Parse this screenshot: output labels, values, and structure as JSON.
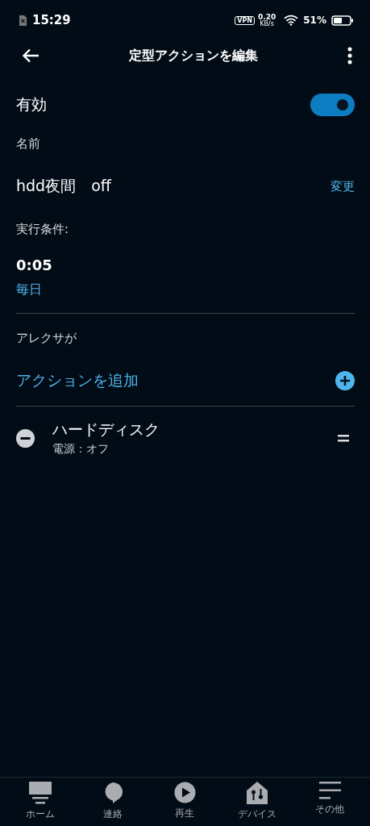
{
  "status_bar": {
    "time": "15:29",
    "vpn": "VPN",
    "speed": "0.20",
    "speed_unit": "KB/s",
    "battery": "51%"
  },
  "header": {
    "title": "定型アクションを編集"
  },
  "enabled": {
    "label": "有効",
    "on": true
  },
  "name": {
    "label": "名前",
    "value": "hdd夜間　off",
    "change": "変更"
  },
  "condition": {
    "label": "実行条件:",
    "time": "0:05",
    "repeat": "毎日"
  },
  "actions": {
    "label": "アレクサが",
    "add": "アクションを追加",
    "items": [
      {
        "title": "ハードディスク",
        "detail": "電源：オフ"
      }
    ]
  },
  "nav": [
    {
      "label": "ホーム",
      "kind": "home",
      "selected": false
    },
    {
      "label": "連絡",
      "kind": "chat",
      "selected": false
    },
    {
      "label": "再生",
      "kind": "play",
      "selected": false
    },
    {
      "label": "デバイス",
      "kind": "devices",
      "selected": false
    },
    {
      "label": "その他",
      "kind": "more",
      "selected": false
    }
  ]
}
